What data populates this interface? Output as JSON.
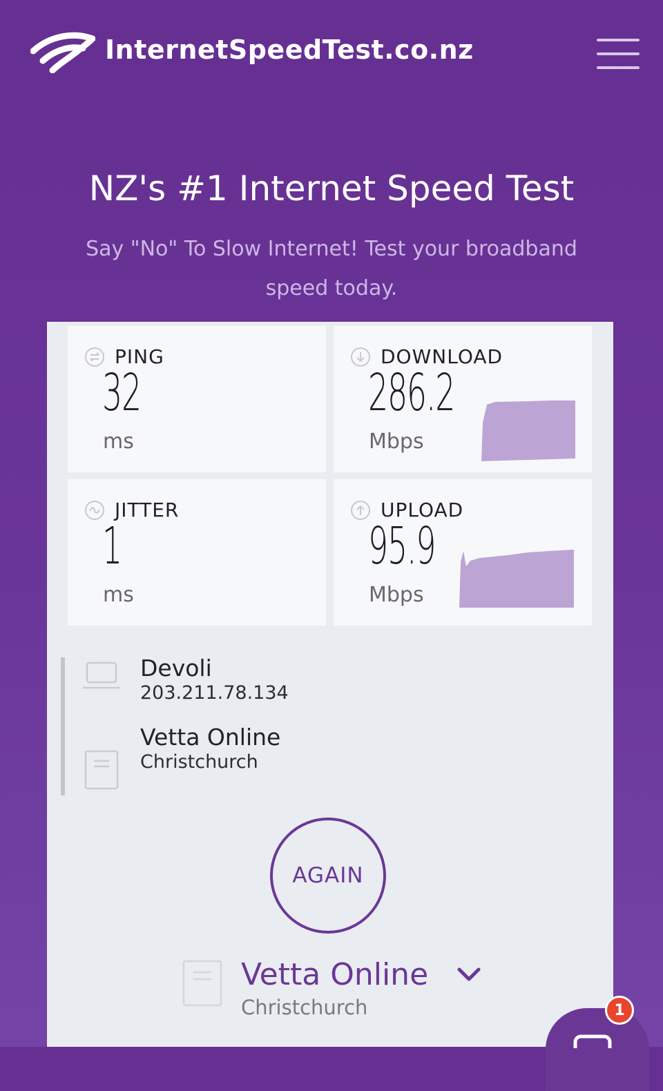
{
  "header": {
    "brand": "InternetSpeedTest.co.nz",
    "logo_icon": "wifi-signal-icon",
    "menu_icon": "hamburger-menu-icon"
  },
  "hero": {
    "title": "NZ's #1 Internet Speed Test",
    "subtitle": "Say \"No\" To Slow Internet! Test your broadband speed today."
  },
  "results": {
    "ping": {
      "label": "PING",
      "value": "32",
      "unit": "ms",
      "icon": "ping-icon"
    },
    "download": {
      "label": "DOWNLOAD",
      "value": "286.2",
      "unit": "Mbps",
      "icon": "download-arrow-icon"
    },
    "jitter": {
      "label": "JITTER",
      "value": "1",
      "unit": "ms",
      "icon": "jitter-wave-icon"
    },
    "upload": {
      "label": "UPLOAD",
      "value": "95.9",
      "unit": "Mbps",
      "icon": "upload-arrow-icon"
    }
  },
  "connection": {
    "isp_name": "Devoli",
    "isp_ip": "203.211.78.134",
    "host_name": "Vetta Online",
    "host_location": "Christchurch"
  },
  "actions": {
    "again_label": "AGAIN"
  },
  "server_select": {
    "name": "Vetta Online",
    "location": "Christchurch"
  },
  "chat": {
    "badge_count": "1"
  },
  "colors": {
    "brand_purple": "#6b3795",
    "background_purple": "#662f92",
    "graph_fill": "#bca5d4",
    "badge_red": "#e8452e"
  }
}
